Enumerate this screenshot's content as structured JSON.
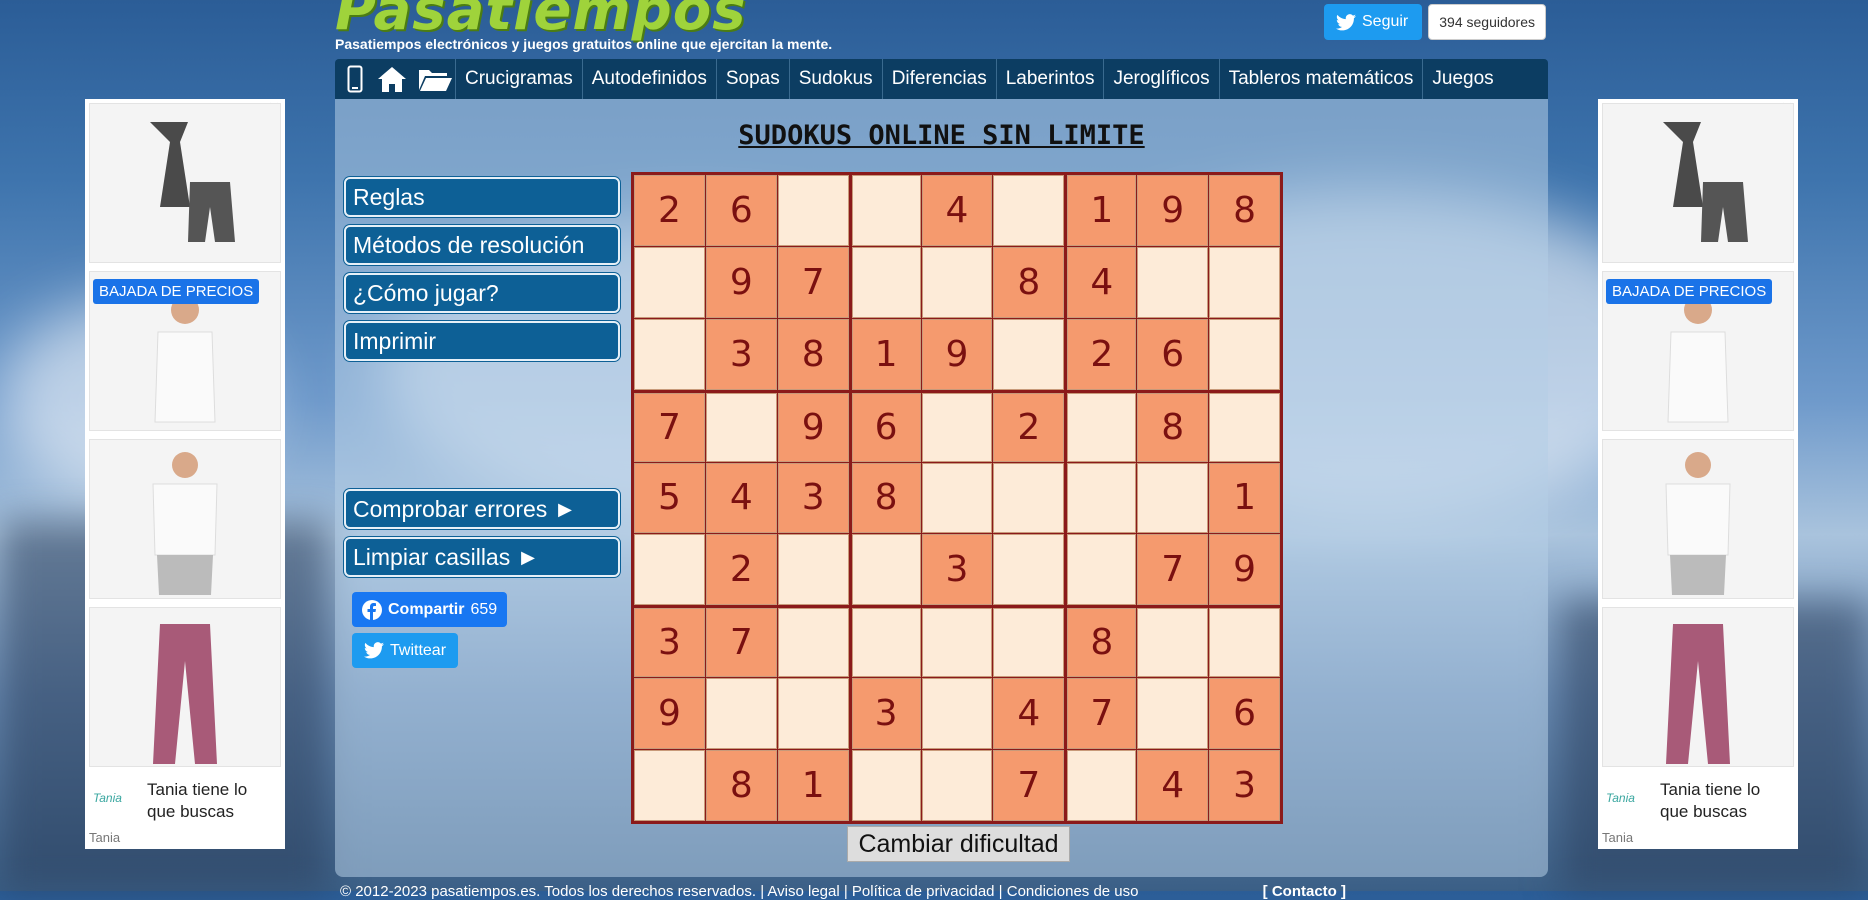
{
  "header": {
    "logo_text": "Pasatiempos",
    "tagline": "Pasatiempos electrónicos y juegos gratuitos online que ejercitan la mente.",
    "twitter_follow_label": "Seguir",
    "twitter_followers": "394 seguidores"
  },
  "nav": {
    "icons": [
      "mobile-icon",
      "home-icon",
      "folder-icon"
    ],
    "items": [
      "Crucigramas",
      "Autodefinidos",
      "Sopas",
      "Sudokus",
      "Diferencias",
      "Laberintos",
      "Jeroglíficos",
      "Tableros matemáticos",
      "Juegos"
    ]
  },
  "page_title": "SUDOKUS ONLINE SIN LIMITE",
  "sidebar": {
    "buttons": [
      "Reglas",
      "Métodos de resolución",
      "¿Cómo jugar?",
      "Imprimir"
    ],
    "actions": [
      "Comprobar errores ►",
      "Limpiar casillas ►"
    ],
    "share_label": "Compartir",
    "share_count": "659",
    "tweet_label": "Twittear"
  },
  "sudoku": {
    "rows": [
      [
        "2",
        "6",
        "",
        "",
        "4",
        "",
        "1",
        "9",
        "8"
      ],
      [
        "",
        "9",
        "7",
        "",
        "",
        "8",
        "4",
        "",
        ""
      ],
      [
        "",
        "3",
        "8",
        "1",
        "9",
        "",
        "2",
        "6",
        ""
      ],
      [
        "7",
        "",
        "9",
        "6",
        "",
        "2",
        "",
        "8",
        ""
      ],
      [
        "5",
        "4",
        "3",
        "8",
        "",
        "",
        "",
        "",
        "1"
      ],
      [
        "",
        "2",
        "",
        "",
        "3",
        "",
        "",
        "7",
        "9"
      ],
      [
        "3",
        "7",
        "",
        "",
        "",
        "",
        "8",
        "",
        ""
      ],
      [
        "9",
        "",
        "",
        "3",
        "",
        "4",
        "7",
        "",
        "6"
      ],
      [
        "",
        "8",
        "1",
        "",
        "",
        "7",
        "",
        "4",
        "3"
      ]
    ]
  },
  "change_difficulty_label": "Cambiar dificultad",
  "footer": {
    "text": "© 2012-2023 pasatiempos.es. Todos los derechos reservados. | Aviso legal | Política de privacidad | Condiciones de uso",
    "contact": "[ Contacto ]"
  },
  "ads": {
    "badge": "BAJADA DE PRECIOS",
    "brand_logo": "Tania",
    "brand_text": "Tania tiene lo que buscas",
    "brand_name": "Tania",
    "info_icon": "info-icon",
    "close_icon": "close-icon"
  },
  "colors": {
    "nav_bg": "#0c3d62",
    "button_bg": "#0d6096",
    "given_cell": "#f59a6e",
    "empty_cell": "#fdebd8",
    "grid_border": "#8b1a1a"
  }
}
